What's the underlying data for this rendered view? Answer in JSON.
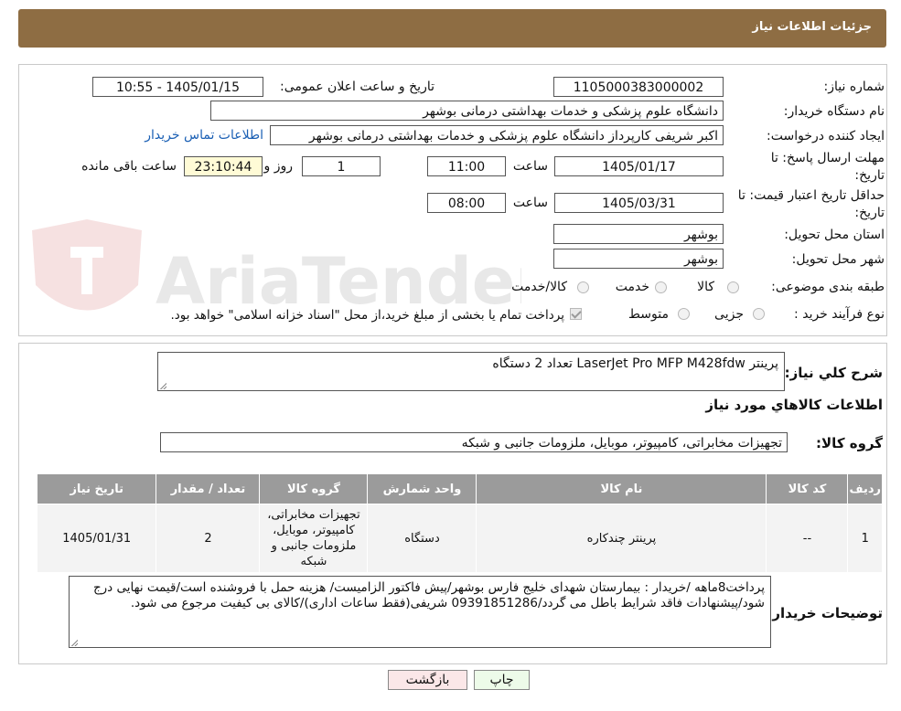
{
  "header": {
    "title": "جزئیات اطلاعات نیاز"
  },
  "watermark": {
    "text": "AriaTender.neT"
  },
  "form": {
    "need_number_label": "شماره نیاز:",
    "need_number": "1105000383000002",
    "announce_label": "تاریخ و ساعت اعلان عمومی:",
    "announce_value": "1405/01/15 - 10:55",
    "buyer_org_label": "نام دستگاه خریدار:",
    "buyer_org": "دانشگاه علوم پزشکی و خدمات بهداشتی درمانی بوشهر",
    "creator_label": "ایجاد کننده درخواست:",
    "creator": "اکبر شریفی کارپرداز دانشگاه علوم پزشکی و خدمات بهداشتی درمانی بوشهر",
    "contact_link": "اطلاعات تماس خریدار",
    "send_deadline_label_1": "مهلت ارسال پاسخ: تا",
    "send_deadline_label_2": "تاریخ:",
    "send_date": "1405/01/17",
    "time_label": "ساعت",
    "send_time": "11:00",
    "days": "1",
    "day_label": "روز و",
    "remaining": "23:10:44",
    "remaining_label": "ساعت باقی مانده",
    "validity_label_1": "حداقل تاریخ اعتبار قیمت: تا",
    "validity_label_2": "تاریخ:",
    "validity_date": "1405/03/31",
    "validity_time": "08:00",
    "province_label": "استان محل تحویل:",
    "province": "بوشهر",
    "city_label": "شهر محل تحویل:",
    "city": "بوشهر",
    "category_label": "طبقه بندی موضوعی:",
    "category_options": [
      "کالا",
      "خدمت",
      "کالا/خدمت"
    ],
    "process_label": "نوع فرآیند خرید :",
    "process_options": [
      "جزیی",
      "متوسط"
    ],
    "payment_note": "پرداخت تمام یا بخشی از مبلغ خرید،از محل \"اسناد خزانه اسلامی\" خواهد بود."
  },
  "summary": {
    "desc_label": "شرح کلي نياز:",
    "desc_value": "پرینتر LaserJet Pro MFP M428fdw تعداد 2 دستگاه",
    "items_title": "اطلاعات کالاهاي مورد نياز",
    "group_label": "گروه کالا:",
    "group_value": "تجهیزات مخابراتی، کامپیوتر، موبایل، ملزومات جانبی و شبکه",
    "table_headers": [
      "ردیف",
      "کد کالا",
      "نام کالا",
      "واحد شمارش",
      "گروه کالا",
      "تعداد / مقدار",
      "تاریخ نیاز"
    ],
    "rows": [
      [
        "1",
        "--",
        "پرینتر چندکاره",
        "دستگاه",
        "تجهیزات مخابراتی، کامپیوتر، موبایل، ملزومات جانبی و شبکه",
        "2",
        "1405/01/31"
      ]
    ],
    "buyer_notes_label": "توضیحات خریدار:",
    "buyer_notes": "پرداخت8ماهه /خریدار : بیمارستان شهدای خلیج فارس بوشهر/پیش فاکتور الزامیست/ هزینه حمل با فروشنده است/قیمت نهایی درج شود/پیشنهادات فاقد شرایط باطل می گردد/09391851286 شریفی(فقط ساعات اداری)/کالای بی کیفیت مرجوع می شود."
  },
  "buttons": {
    "print": "چاپ",
    "back": "بازگشت"
  }
}
